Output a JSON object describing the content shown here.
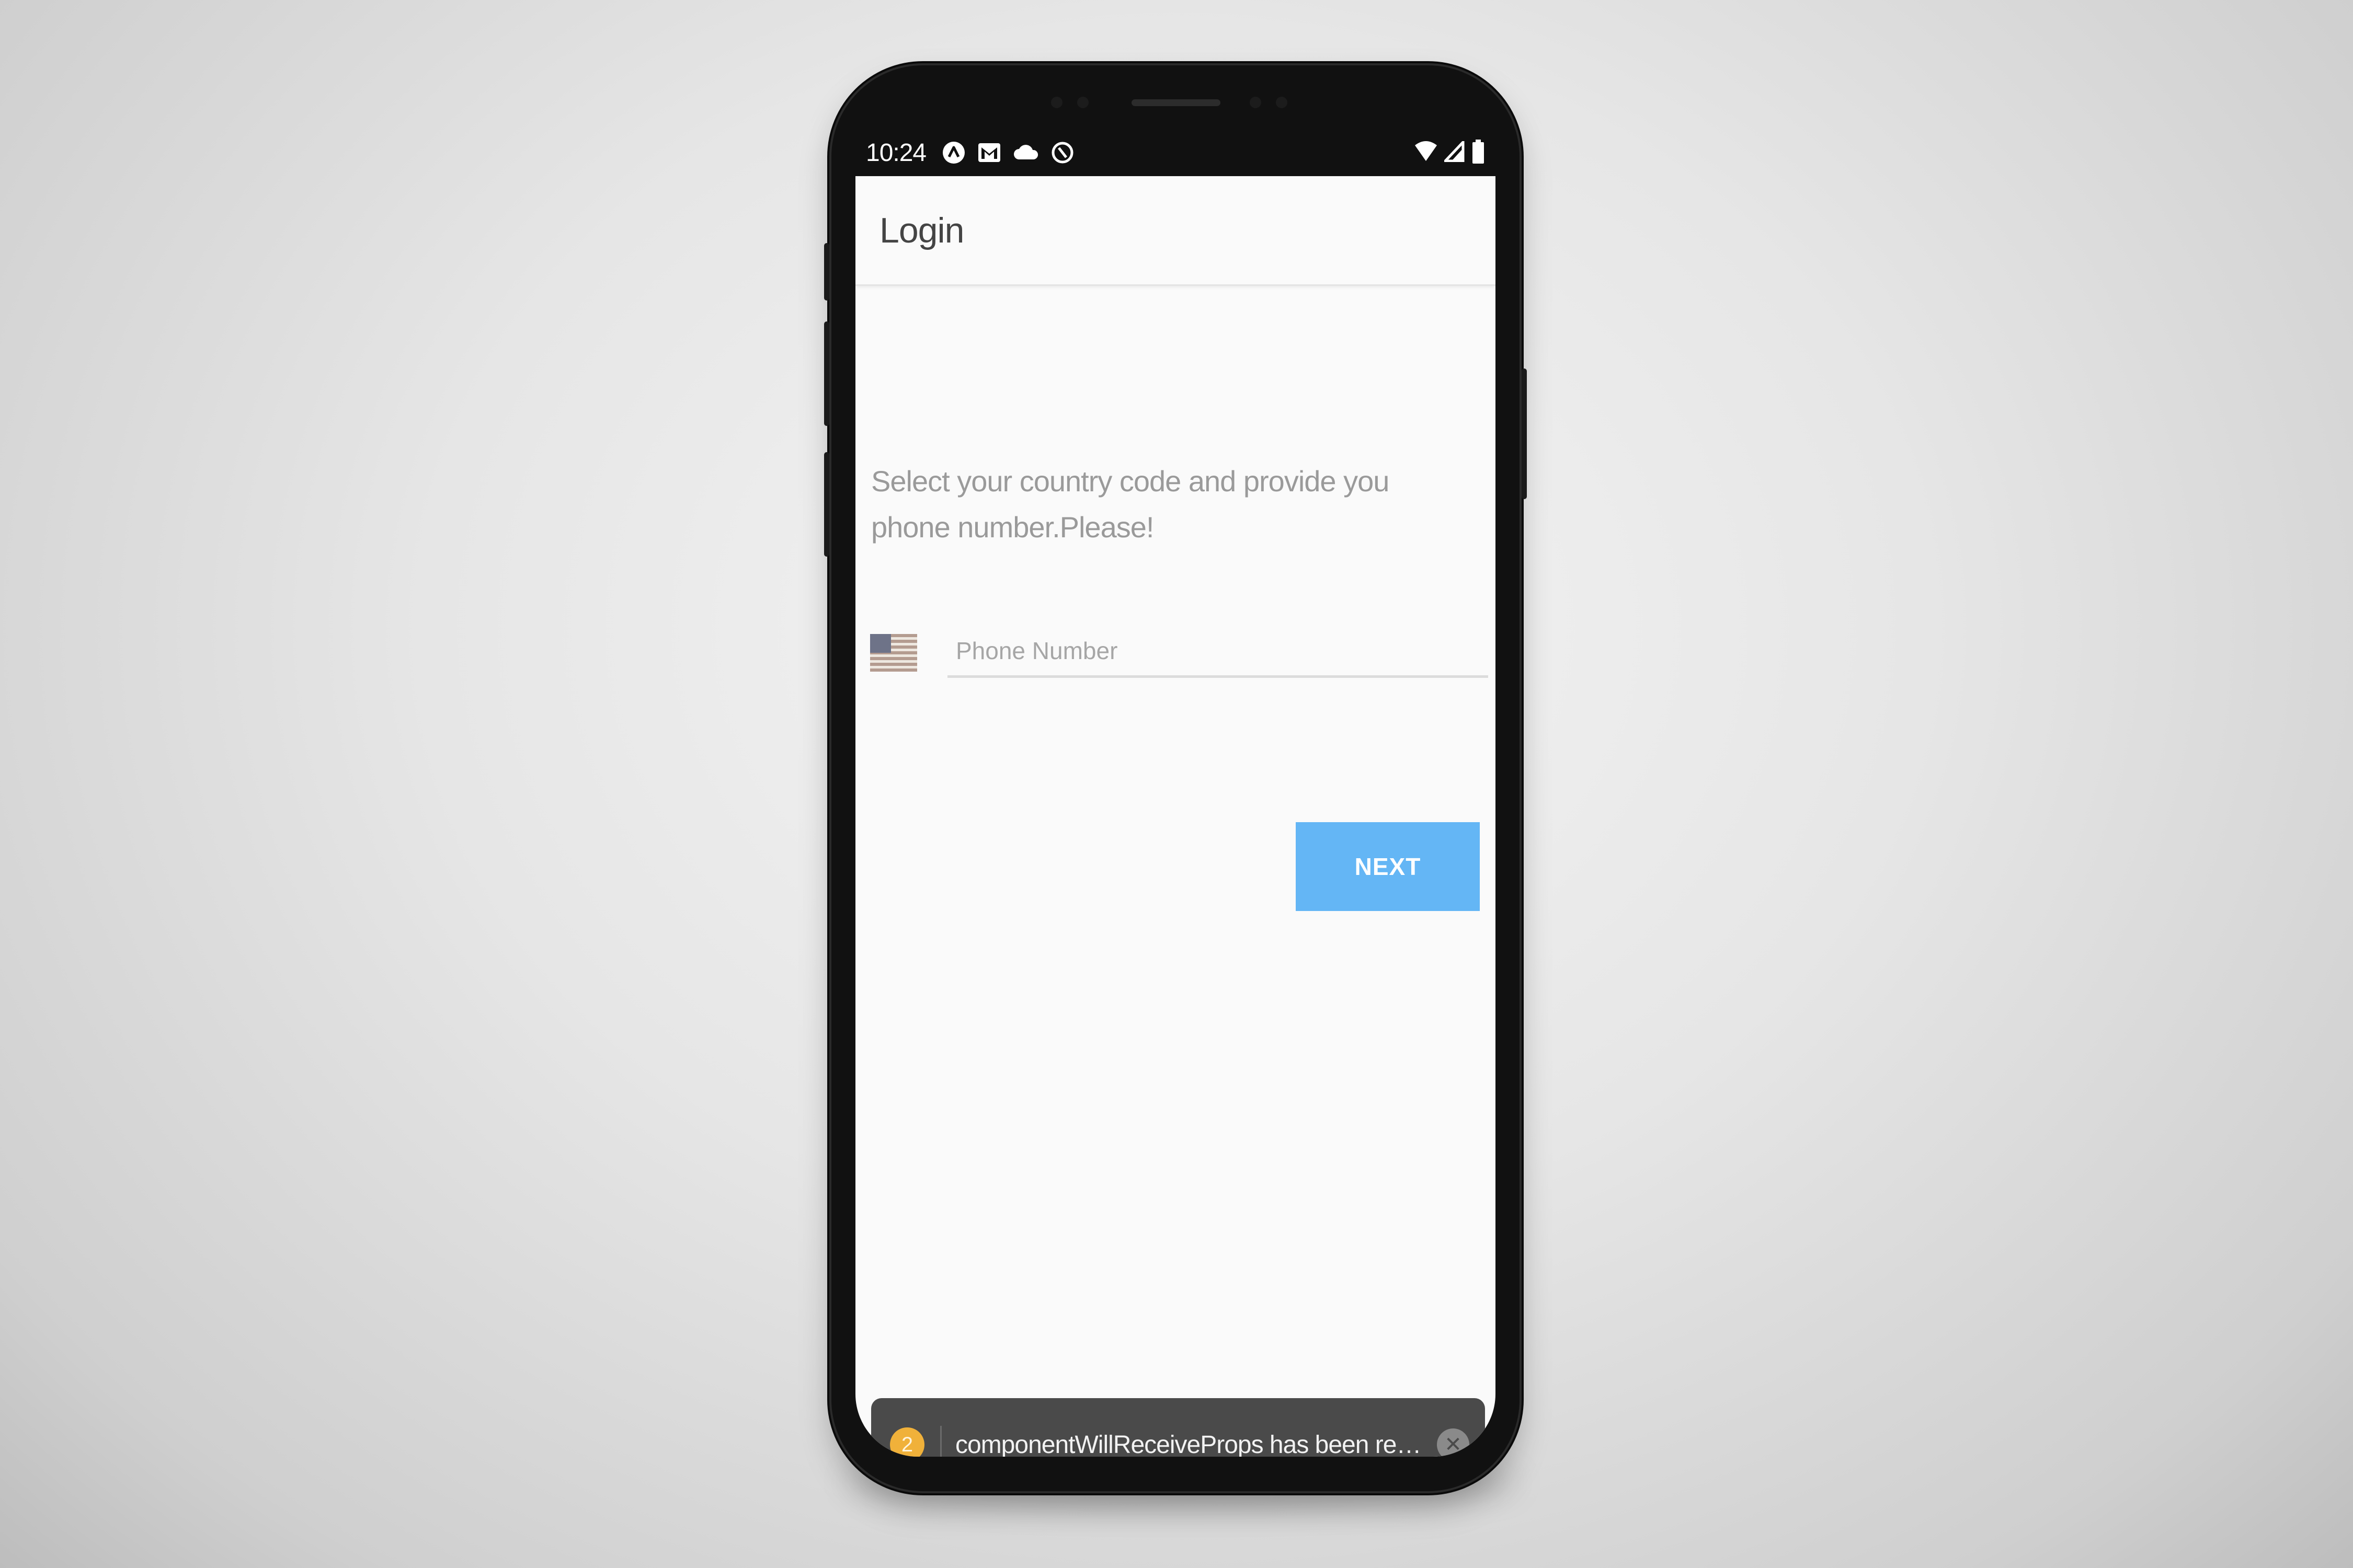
{
  "status_bar": {
    "time": "10:24",
    "left_icons": [
      "react-icon",
      "gmail-icon",
      "cloud-icon",
      "sync-icon"
    ],
    "right_icons": [
      "wifi-icon",
      "signal-icon",
      "battery-icon"
    ]
  },
  "app_bar": {
    "title": "Login"
  },
  "login": {
    "instructions": "Select your country code and provide you phone number.Please!",
    "country_flag": "us-flag-icon",
    "phone_placeholder": "Phone Number",
    "phone_value": "",
    "next_label": "NEXT"
  },
  "toast": {
    "count": "2",
    "message": "componentWillReceiveProps has been rename..."
  },
  "colors": {
    "accent_button": "#64b6f5",
    "toast_bg": "#4a4a4a",
    "badge": "#f0b13a"
  }
}
